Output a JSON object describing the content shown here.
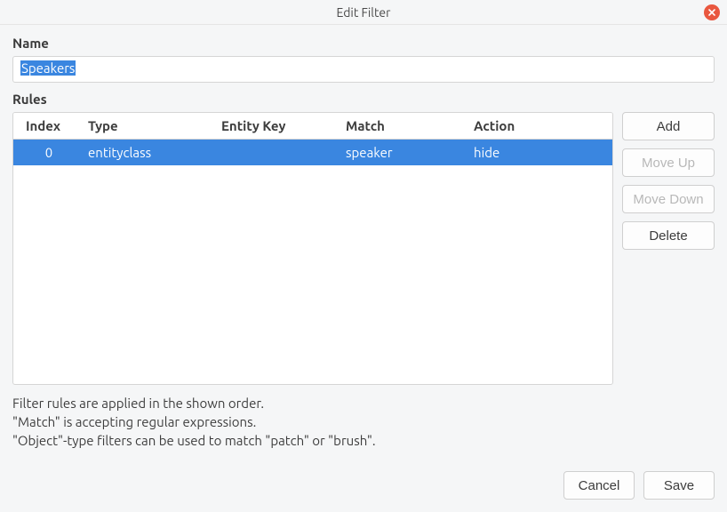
{
  "window": {
    "title": "Edit Filter"
  },
  "labels": {
    "name": "Name",
    "rules": "Rules"
  },
  "name_field": {
    "value": "Speakers",
    "selected": true
  },
  "table": {
    "columns": {
      "index": "Index",
      "type": "Type",
      "entity_key": "Entity Key",
      "match": "Match",
      "action": "Action"
    },
    "rows": [
      {
        "index": "0",
        "type": "entityclass",
        "entity_key": "",
        "match": "speaker",
        "action": "hide",
        "selected": true
      }
    ]
  },
  "buttons": {
    "add": "Add",
    "move_up": "Move Up",
    "move_down": "Move Down",
    "delete": "Delete",
    "cancel": "Cancel",
    "save": "Save"
  },
  "button_state": {
    "move_up_disabled": true,
    "move_down_disabled": true
  },
  "help": {
    "line1": "Filter rules are applied in the shown order.",
    "line2": "\"Match\" is accepting regular expressions.",
    "line3": "\"Object\"-type filters can be used to match \"patch\" or \"brush\"."
  }
}
